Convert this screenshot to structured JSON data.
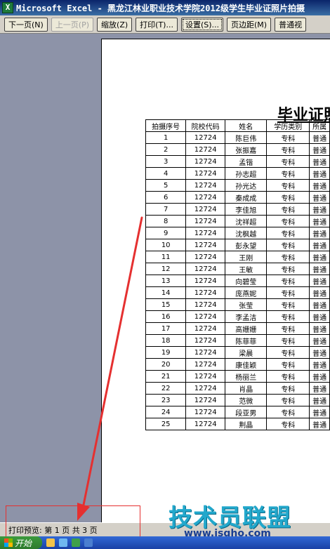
{
  "window": {
    "title": "Microsoft Excel - 黑龙江林业职业技术学院2012级学生毕业证照片拍摄"
  },
  "toolbar": {
    "next_page": "下一页(N)",
    "prev_page": "上一页(P)",
    "zoom": "缩放(Z)",
    "print": "打印(T)...",
    "setup": "设置(S)...",
    "margins": "页边距(M)",
    "normal_view": "普通视"
  },
  "sheet": {
    "title": "毕业证照",
    "headers": [
      "拍摄序号",
      "院校代码",
      "姓名",
      "学历类别",
      "所属"
    ],
    "rows": [
      [
        "1",
        "12724",
        "陈巨伟",
        "专科",
        "普通"
      ],
      [
        "2",
        "12724",
        "张振嘉",
        "专科",
        "普通"
      ],
      [
        "3",
        "12724",
        "孟锴",
        "专科",
        "普通"
      ],
      [
        "4",
        "12724",
        "孙志超",
        "专科",
        "普通"
      ],
      [
        "5",
        "12724",
        "孙光达",
        "专科",
        "普通"
      ],
      [
        "6",
        "12724",
        "秦成成",
        "专科",
        "普通"
      ],
      [
        "7",
        "12724",
        "李佳旭",
        "专科",
        "普通"
      ],
      [
        "8",
        "12724",
        "沈祥超",
        "专科",
        "普通"
      ],
      [
        "9",
        "12724",
        "沈枫越",
        "专科",
        "普通"
      ],
      [
        "10",
        "12724",
        "彭永望",
        "专科",
        "普通"
      ],
      [
        "11",
        "12724",
        "王刚",
        "专科",
        "普通"
      ],
      [
        "12",
        "12724",
        "王敏",
        "专科",
        "普通"
      ],
      [
        "13",
        "12724",
        "向碧莹",
        "专科",
        "普通"
      ],
      [
        "14",
        "12724",
        "庞燕妮",
        "专科",
        "普通"
      ],
      [
        "15",
        "12724",
        "张莹",
        "专科",
        "普通"
      ],
      [
        "16",
        "12724",
        "李孟洁",
        "专科",
        "普通"
      ],
      [
        "17",
        "12724",
        "高姗姗",
        "专科",
        "普通"
      ],
      [
        "18",
        "12724",
        "陈菲菲",
        "专科",
        "普通"
      ],
      [
        "19",
        "12724",
        "梁晨",
        "专科",
        "普通"
      ],
      [
        "20",
        "12724",
        "康佳颖",
        "专科",
        "普通"
      ],
      [
        "21",
        "12724",
        "杨丽兰",
        "专科",
        "普通"
      ],
      [
        "22",
        "12724",
        "肖晶",
        "专科",
        "普通"
      ],
      [
        "23",
        "12724",
        "范微",
        "专科",
        "普通"
      ],
      [
        "24",
        "12724",
        "段亚男",
        "专科",
        "普通"
      ],
      [
        "25",
        "12724",
        "荆晶",
        "专科",
        "普通"
      ]
    ]
  },
  "status": {
    "text": "打印预览: 第 1 页   共 3 页"
  },
  "taskbar": {
    "start_label": "开始"
  },
  "watermark": {
    "text": "技术员联盟",
    "url": "www.jsgho.com"
  },
  "colors": {
    "annotation_red": "#e53030",
    "workspace_gray": "#8d93a8"
  }
}
